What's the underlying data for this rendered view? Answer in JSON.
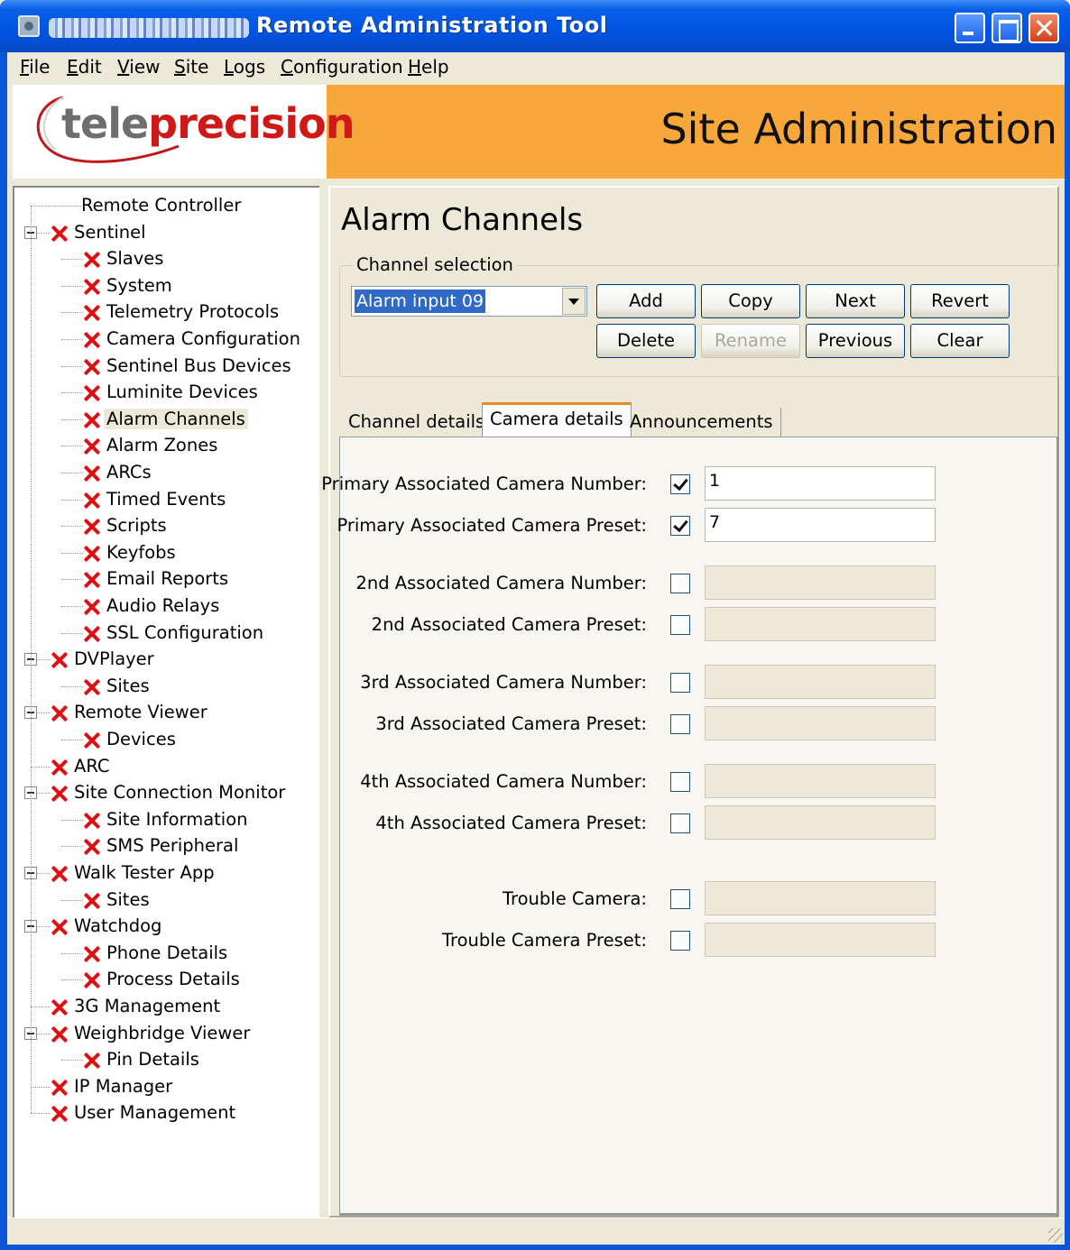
{
  "window": {
    "title": "Remote Administration Tool"
  },
  "menu": [
    "File",
    "Edit",
    "View",
    "Site",
    "Logs",
    "Configuration",
    "Help"
  ],
  "header": {
    "logo_part1": "tele",
    "logo_part2": "precision",
    "title": "Site Administration"
  },
  "tree": [
    {
      "label": "Remote Controller",
      "level": 0,
      "icon": "none"
    },
    {
      "label": "Sentinel",
      "level": 0,
      "icon": "x",
      "expander": "minus"
    },
    {
      "label": "Slaves",
      "level": 1,
      "icon": "x"
    },
    {
      "label": "System",
      "level": 1,
      "icon": "x"
    },
    {
      "label": "Telemetry Protocols",
      "level": 1,
      "icon": "x"
    },
    {
      "label": "Camera Configuration",
      "level": 1,
      "icon": "x"
    },
    {
      "label": "Sentinel Bus Devices",
      "level": 1,
      "icon": "x"
    },
    {
      "label": "Luminite Devices",
      "level": 1,
      "icon": "x"
    },
    {
      "label": "Alarm Channels",
      "level": 1,
      "icon": "x",
      "selected": true
    },
    {
      "label": "Alarm Zones",
      "level": 1,
      "icon": "x"
    },
    {
      "label": "ARCs",
      "level": 1,
      "icon": "x"
    },
    {
      "label": "Timed Events",
      "level": 1,
      "icon": "x"
    },
    {
      "label": "Scripts",
      "level": 1,
      "icon": "x"
    },
    {
      "label": "Keyfobs",
      "level": 1,
      "icon": "x"
    },
    {
      "label": "Email Reports",
      "level": 1,
      "icon": "x"
    },
    {
      "label": "Audio Relays",
      "level": 1,
      "icon": "x"
    },
    {
      "label": "SSL Configuration",
      "level": 1,
      "icon": "x"
    },
    {
      "label": "DVPlayer",
      "level": 0,
      "icon": "x",
      "expander": "minus"
    },
    {
      "label": "Sites",
      "level": 1,
      "icon": "x"
    },
    {
      "label": "Remote Viewer",
      "level": 0,
      "icon": "x",
      "expander": "minus"
    },
    {
      "label": "Devices",
      "level": 1,
      "icon": "x"
    },
    {
      "label": "ARC",
      "level": 0,
      "icon": "x"
    },
    {
      "label": "Site Connection Monitor",
      "level": 0,
      "icon": "x",
      "expander": "minus"
    },
    {
      "label": "Site Information",
      "level": 1,
      "icon": "x"
    },
    {
      "label": "SMS Peripheral",
      "level": 1,
      "icon": "x"
    },
    {
      "label": "Walk Tester App",
      "level": 0,
      "icon": "x",
      "expander": "minus"
    },
    {
      "label": "Sites",
      "level": 1,
      "icon": "x"
    },
    {
      "label": "Watchdog",
      "level": 0,
      "icon": "x",
      "expander": "minus"
    },
    {
      "label": "Phone Details",
      "level": 1,
      "icon": "x"
    },
    {
      "label": "Process Details",
      "level": 1,
      "icon": "x"
    },
    {
      "label": "3G Management",
      "level": 0,
      "icon": "x"
    },
    {
      "label": "Weighbridge Viewer",
      "level": 0,
      "icon": "x",
      "expander": "minus"
    },
    {
      "label": "Pin Details",
      "level": 1,
      "icon": "x"
    },
    {
      "label": "IP Manager",
      "level": 0,
      "icon": "x"
    },
    {
      "label": "User Management",
      "level": 0,
      "icon": "x"
    }
  ],
  "main": {
    "title": "Alarm Channels",
    "channel_selection": {
      "legend": "Channel selection",
      "selected": "Alarm input 09",
      "buttons": {
        "add": "Add",
        "copy": "Copy",
        "next": "Next",
        "revert": "Revert",
        "delete": "Delete",
        "rename": "Rename",
        "previous": "Previous",
        "clear": "Clear"
      }
    },
    "tabs": [
      "Channel details",
      "Camera details",
      "Announcements"
    ],
    "active_tab": "Camera details",
    "fields": [
      {
        "label": "Primary Associated Camera Number:",
        "checked": true,
        "value": "1"
      },
      {
        "label": "Primary Associated Camera Preset:",
        "checked": true,
        "value": "7"
      },
      {
        "label": "2nd Associated Camera Number:",
        "checked": false,
        "value": ""
      },
      {
        "label": "2nd Associated Camera Preset:",
        "checked": false,
        "value": ""
      },
      {
        "label": "3rd Associated Camera Number:",
        "checked": false,
        "value": ""
      },
      {
        "label": "3rd Associated Camera Preset:",
        "checked": false,
        "value": ""
      },
      {
        "label": "4th Associated Camera Number:",
        "checked": false,
        "value": ""
      },
      {
        "label": "4th Associated Camera Preset:",
        "checked": false,
        "value": ""
      },
      {
        "label": "Trouble Camera:",
        "checked": false,
        "value": ""
      },
      {
        "label": "Trouble Camera Preset:",
        "checked": false,
        "value": ""
      }
    ]
  },
  "colors": {
    "accent_orange": "#f8a83a",
    "error_red": "#d11111",
    "xp_blue": "#0054e3"
  }
}
